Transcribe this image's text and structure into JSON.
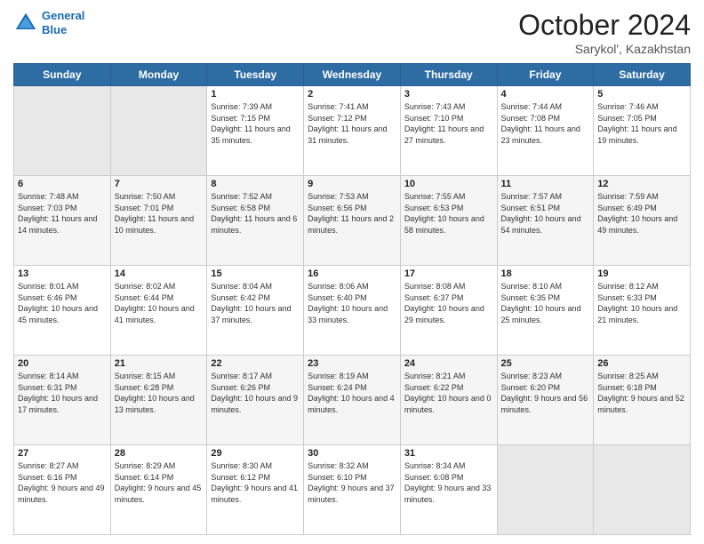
{
  "header": {
    "logo_line1": "General",
    "logo_line2": "Blue",
    "title": "October 2024",
    "subtitle": "Sarykol', Kazakhstan"
  },
  "days_of_week": [
    "Sunday",
    "Monday",
    "Tuesday",
    "Wednesday",
    "Thursday",
    "Friday",
    "Saturday"
  ],
  "weeks": [
    [
      {
        "day": null,
        "sunrise": null,
        "sunset": null,
        "daylight": null
      },
      {
        "day": null,
        "sunrise": null,
        "sunset": null,
        "daylight": null
      },
      {
        "day": "1",
        "sunrise": "Sunrise: 7:39 AM",
        "sunset": "Sunset: 7:15 PM",
        "daylight": "Daylight: 11 hours and 35 minutes."
      },
      {
        "day": "2",
        "sunrise": "Sunrise: 7:41 AM",
        "sunset": "Sunset: 7:12 PM",
        "daylight": "Daylight: 11 hours and 31 minutes."
      },
      {
        "day": "3",
        "sunrise": "Sunrise: 7:43 AM",
        "sunset": "Sunset: 7:10 PM",
        "daylight": "Daylight: 11 hours and 27 minutes."
      },
      {
        "day": "4",
        "sunrise": "Sunrise: 7:44 AM",
        "sunset": "Sunset: 7:08 PM",
        "daylight": "Daylight: 11 hours and 23 minutes."
      },
      {
        "day": "5",
        "sunrise": "Sunrise: 7:46 AM",
        "sunset": "Sunset: 7:05 PM",
        "daylight": "Daylight: 11 hours and 19 minutes."
      }
    ],
    [
      {
        "day": "6",
        "sunrise": "Sunrise: 7:48 AM",
        "sunset": "Sunset: 7:03 PM",
        "daylight": "Daylight: 11 hours and 14 minutes."
      },
      {
        "day": "7",
        "sunrise": "Sunrise: 7:50 AM",
        "sunset": "Sunset: 7:01 PM",
        "daylight": "Daylight: 11 hours and 10 minutes."
      },
      {
        "day": "8",
        "sunrise": "Sunrise: 7:52 AM",
        "sunset": "Sunset: 6:58 PM",
        "daylight": "Daylight: 11 hours and 6 minutes."
      },
      {
        "day": "9",
        "sunrise": "Sunrise: 7:53 AM",
        "sunset": "Sunset: 6:56 PM",
        "daylight": "Daylight: 11 hours and 2 minutes."
      },
      {
        "day": "10",
        "sunrise": "Sunrise: 7:55 AM",
        "sunset": "Sunset: 6:53 PM",
        "daylight": "Daylight: 10 hours and 58 minutes."
      },
      {
        "day": "11",
        "sunrise": "Sunrise: 7:57 AM",
        "sunset": "Sunset: 6:51 PM",
        "daylight": "Daylight: 10 hours and 54 minutes."
      },
      {
        "day": "12",
        "sunrise": "Sunrise: 7:59 AM",
        "sunset": "Sunset: 6:49 PM",
        "daylight": "Daylight: 10 hours and 49 minutes."
      }
    ],
    [
      {
        "day": "13",
        "sunrise": "Sunrise: 8:01 AM",
        "sunset": "Sunset: 6:46 PM",
        "daylight": "Daylight: 10 hours and 45 minutes."
      },
      {
        "day": "14",
        "sunrise": "Sunrise: 8:02 AM",
        "sunset": "Sunset: 6:44 PM",
        "daylight": "Daylight: 10 hours and 41 minutes."
      },
      {
        "day": "15",
        "sunrise": "Sunrise: 8:04 AM",
        "sunset": "Sunset: 6:42 PM",
        "daylight": "Daylight: 10 hours and 37 minutes."
      },
      {
        "day": "16",
        "sunrise": "Sunrise: 8:06 AM",
        "sunset": "Sunset: 6:40 PM",
        "daylight": "Daylight: 10 hours and 33 minutes."
      },
      {
        "day": "17",
        "sunrise": "Sunrise: 8:08 AM",
        "sunset": "Sunset: 6:37 PM",
        "daylight": "Daylight: 10 hours and 29 minutes."
      },
      {
        "day": "18",
        "sunrise": "Sunrise: 8:10 AM",
        "sunset": "Sunset: 6:35 PM",
        "daylight": "Daylight: 10 hours and 25 minutes."
      },
      {
        "day": "19",
        "sunrise": "Sunrise: 8:12 AM",
        "sunset": "Sunset: 6:33 PM",
        "daylight": "Daylight: 10 hours and 21 minutes."
      }
    ],
    [
      {
        "day": "20",
        "sunrise": "Sunrise: 8:14 AM",
        "sunset": "Sunset: 6:31 PM",
        "daylight": "Daylight: 10 hours and 17 minutes."
      },
      {
        "day": "21",
        "sunrise": "Sunrise: 8:15 AM",
        "sunset": "Sunset: 6:28 PM",
        "daylight": "Daylight: 10 hours and 13 minutes."
      },
      {
        "day": "22",
        "sunrise": "Sunrise: 8:17 AM",
        "sunset": "Sunset: 6:26 PM",
        "daylight": "Daylight: 10 hours and 9 minutes."
      },
      {
        "day": "23",
        "sunrise": "Sunrise: 8:19 AM",
        "sunset": "Sunset: 6:24 PM",
        "daylight": "Daylight: 10 hours and 4 minutes."
      },
      {
        "day": "24",
        "sunrise": "Sunrise: 8:21 AM",
        "sunset": "Sunset: 6:22 PM",
        "daylight": "Daylight: 10 hours and 0 minutes."
      },
      {
        "day": "25",
        "sunrise": "Sunrise: 8:23 AM",
        "sunset": "Sunset: 6:20 PM",
        "daylight": "Daylight: 9 hours and 56 minutes."
      },
      {
        "day": "26",
        "sunrise": "Sunrise: 8:25 AM",
        "sunset": "Sunset: 6:18 PM",
        "daylight": "Daylight: 9 hours and 52 minutes."
      }
    ],
    [
      {
        "day": "27",
        "sunrise": "Sunrise: 8:27 AM",
        "sunset": "Sunset: 6:16 PM",
        "daylight": "Daylight: 9 hours and 49 minutes."
      },
      {
        "day": "28",
        "sunrise": "Sunrise: 8:29 AM",
        "sunset": "Sunset: 6:14 PM",
        "daylight": "Daylight: 9 hours and 45 minutes."
      },
      {
        "day": "29",
        "sunrise": "Sunrise: 8:30 AM",
        "sunset": "Sunset: 6:12 PM",
        "daylight": "Daylight: 9 hours and 41 minutes."
      },
      {
        "day": "30",
        "sunrise": "Sunrise: 8:32 AM",
        "sunset": "Sunset: 6:10 PM",
        "daylight": "Daylight: 9 hours and 37 minutes."
      },
      {
        "day": "31",
        "sunrise": "Sunrise: 8:34 AM",
        "sunset": "Sunset: 6:08 PM",
        "daylight": "Daylight: 9 hours and 33 minutes."
      },
      {
        "day": null,
        "sunrise": null,
        "sunset": null,
        "daylight": null
      },
      {
        "day": null,
        "sunrise": null,
        "sunset": null,
        "daylight": null
      }
    ]
  ]
}
